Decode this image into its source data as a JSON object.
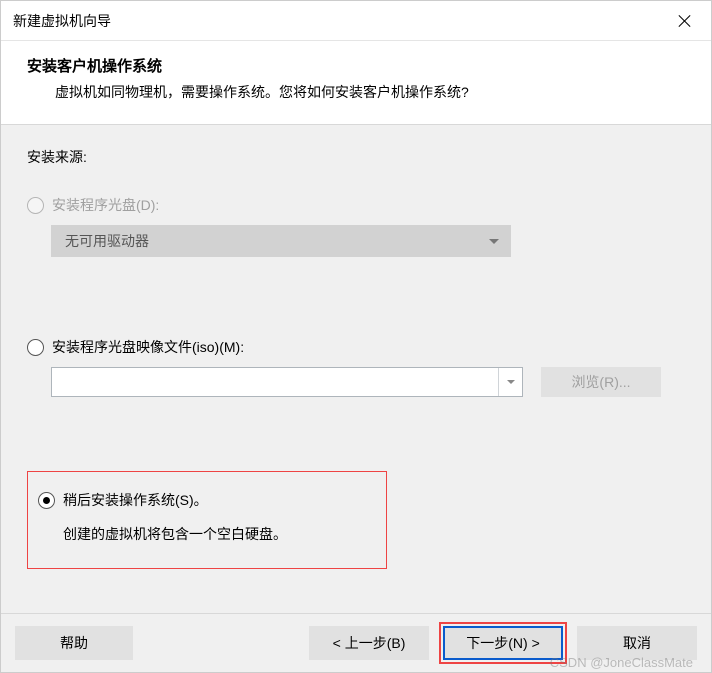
{
  "window": {
    "title": "新建虚拟机向导"
  },
  "header": {
    "title": "安装客户机操作系统",
    "subtitle": "虚拟机如同物理机，需要操作系统。您将如何安装客户机操作系统?"
  },
  "source_label": "安装来源:",
  "opt_disc": {
    "label": "安装程序光盘(D):",
    "combo_value": "无可用驱动器"
  },
  "opt_iso": {
    "label": "安装程序光盘映像文件(iso)(M):",
    "input_value": "",
    "browse_label": "浏览(R)..."
  },
  "opt_later": {
    "label": "稍后安装操作系统(S)。",
    "desc": "创建的虚拟机将包含一个空白硬盘。"
  },
  "footer": {
    "help": "帮助",
    "back": "< 上一步(B)",
    "next": "下一步(N) >",
    "cancel": "取消"
  },
  "watermark": "CSDN @JoneClassMate"
}
